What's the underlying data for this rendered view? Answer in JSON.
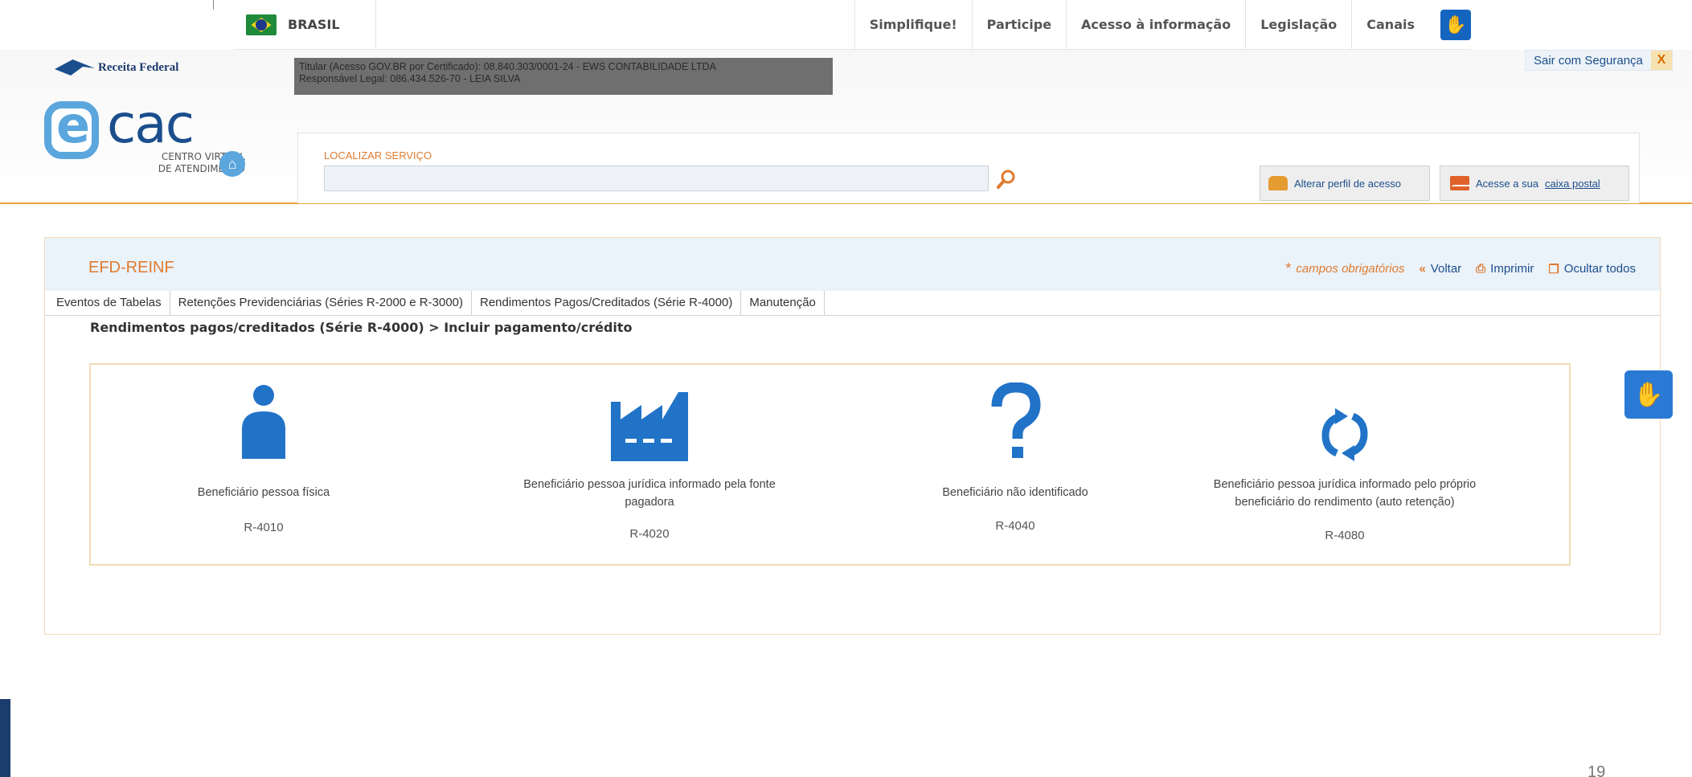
{
  "govbar": {
    "country": "BRASIL",
    "links": [
      "Simplifique!",
      "Participe",
      "Acesso à informação",
      "Legislação",
      "Canais"
    ]
  },
  "header": {
    "agency": "Receita Federal",
    "ecac_logo": "cac",
    "ecac_subtitle_1": "CENTRO VIRTUAL",
    "ecac_subtitle_2": "DE ATENDIMENTO",
    "titular_line1": "Titular (Acesso GOV.BR por Certificado): 08.840.303/0001-24 - EWS CONTABILIDADE LTDA",
    "titular_line2": "Responsável Legal: 086.434.526-70 - LEIA SILVA",
    "logout_label": "Sair com Segurança",
    "logout_close": "X",
    "search_label": "LOCALIZAR SERVIÇO",
    "search_value": "",
    "profile_button": "Alterar perfil de acesso",
    "mailbox_prefix": "Acesse a sua",
    "mailbox_link": "caixa postal"
  },
  "content": {
    "title": "EFD-REINF",
    "required_note": "campos obrigatórios",
    "toolbar": {
      "back": "Voltar",
      "print": "Imprimir",
      "hide": "Ocultar todos"
    },
    "tabs": [
      "Eventos de Tabelas",
      "Retenções Previdenciárias (Séries R-2000 e R-3000)",
      "Rendimentos Pagos/Creditados (Série R-4000)",
      "Manutenção"
    ],
    "breadcrumb": "Rendimentos pagos/creditados (Série R-4000) > Incluir pagamento/crédito",
    "options": [
      {
        "icon": "person-icon",
        "label": "Beneficiário pessoa física",
        "code": "R-4010"
      },
      {
        "icon": "factory-icon",
        "label_1": "Beneficiário pessoa jurídica informado pela fonte",
        "label_2": "pagadora",
        "code": "R-4020"
      },
      {
        "icon": "question-icon",
        "label": "Beneficiário não identificado",
        "code": "R-4040"
      },
      {
        "icon": "refresh-icon",
        "label_1": "Beneficiário pessoa jurídica informado pelo próprio",
        "label_2": "beneficiário do rendimento (auto retenção)",
        "code": "R-4080"
      }
    ]
  },
  "page_number": "19",
  "colors": {
    "accent_orange": "#e07b30",
    "brand_blue": "#1b4e8c",
    "icon_blue": "#2173c8",
    "vlibras_blue": "#2a7ad5"
  }
}
